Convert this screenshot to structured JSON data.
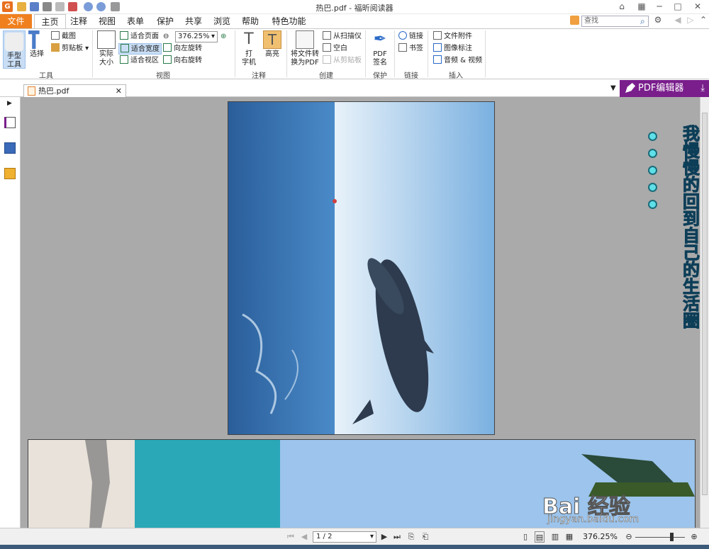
{
  "window": {
    "title": "热巴.pdf - 福昕阅读器",
    "app_icon": "G"
  },
  "menu": {
    "file": "文件",
    "tabs": [
      "主页",
      "注释",
      "视图",
      "表单",
      "保护",
      "共享",
      "浏览",
      "帮助",
      "特色功能"
    ],
    "active_tab": "主页",
    "search_placeholder": "查找"
  },
  "ribbon": {
    "tools": {
      "hand": "手型\n工具",
      "select": "选择",
      "snapshot": "截图",
      "clipboard": "剪贴板",
      "label": "工具"
    },
    "view": {
      "actual_size": "实际\n大小",
      "fit_page": "适合页面",
      "fit_width": "适合宽度",
      "fit_visible": "适合视区",
      "zoom_value": "376.25%",
      "rotate_left": "向左旋转",
      "rotate_right": "向右旋转",
      "label": "视图"
    },
    "comment": {
      "typewriter": "打\n字机",
      "highlight": "高亮",
      "label": "注释"
    },
    "create": {
      "convert": "将文件转\n换为PDF",
      "from_scanner": "从扫描仪",
      "blank": "空白",
      "from_clipboard": "从剪贴板",
      "label": "创建"
    },
    "protect": {
      "sign": "PDF\n签名",
      "label": "保护"
    },
    "links": {
      "link": "链接",
      "bookmark": "书签",
      "label": "链接"
    },
    "insert": {
      "attachment": "文件附件",
      "image": "图像标注",
      "media": "音频 & 视频",
      "label": "插入"
    }
  },
  "doc_tab": {
    "name": "热巴.pdf",
    "editor_button": "PDF编辑器"
  },
  "page_overlay": {
    "vertical_text": "我慢慢的回到自己的生活圈"
  },
  "status": {
    "page": "1 / 2",
    "zoom": "376.25%"
  },
  "watermark": {
    "logo": "Bai 经验",
    "url": "jingyan.baidu.com"
  },
  "colors": {
    "file_tab": "#f0801e",
    "editor_button": "#7a1e8c",
    "ocean": "#2a6aa8",
    "sky": "#a8cdee"
  }
}
